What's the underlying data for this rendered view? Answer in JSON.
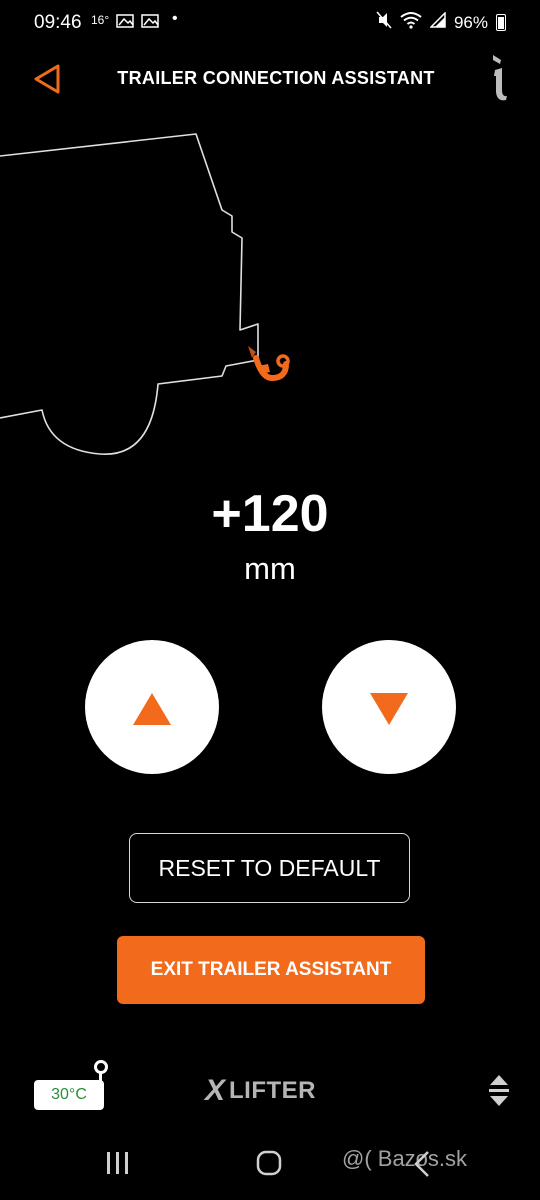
{
  "status_bar": {
    "time": "09:46",
    "temperature": "16°",
    "battery": "96%",
    "icons": [
      "photo-notification-icon",
      "photo-notification-icon",
      "dot-icon",
      "mute-icon",
      "wifi-icon",
      "signal-icon",
      "battery-icon"
    ]
  },
  "header": {
    "title": "TRAILER CONNECTION ASSISTANT",
    "back_icon": "triangle-back-icon",
    "info_icon": "info-icon"
  },
  "hitch_height": {
    "value": "+120",
    "unit": "mm"
  },
  "controls": {
    "up_icon": "triangle-up-icon",
    "down_icon": "triangle-down-icon",
    "reset_label": "RESET TO DEFAULT",
    "exit_label": "EXIT TRAILER ASSISTANT"
  },
  "footer": {
    "temperature_label": "30°C",
    "logo_text": "LIFTER",
    "menu_icon": "up-down-toggle-icon"
  },
  "watermark": "@( Bazos.sk",
  "colors": {
    "accent": "#f26a1b",
    "background": "#000000",
    "temp_text": "#2a8f3a",
    "logo": "#b5b5b5"
  }
}
